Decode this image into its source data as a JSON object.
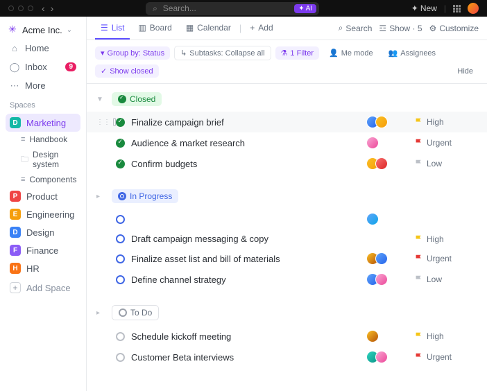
{
  "topbar": {
    "search_placeholder": "Search...",
    "ai_label": "AI",
    "new_label": "New"
  },
  "workspace": {
    "name": "Acme Inc."
  },
  "nav": {
    "home": "Home",
    "inbox": "Inbox",
    "inbox_badge": "9",
    "more": "More"
  },
  "section_spaces": "Spaces",
  "spaces": [
    {
      "letter": "D",
      "color": "#14b8a6",
      "label": "Marketing",
      "active": true
    },
    {
      "letter": "P",
      "color": "#ef4444",
      "label": "Product"
    },
    {
      "letter": "E",
      "color": "#f59e0b",
      "label": "Engineering"
    },
    {
      "letter": "D",
      "color": "#3b82f6",
      "label": "Design"
    },
    {
      "letter": "F",
      "color": "#8b5cf6",
      "label": "Finance"
    },
    {
      "letter": "H",
      "color": "#f97316",
      "label": "HR"
    }
  ],
  "marketing_subs": [
    {
      "icon": "≡",
      "label": "Handbook"
    },
    {
      "icon": "🗀",
      "label": "Design system"
    },
    {
      "icon": "≡",
      "label": "Components"
    }
  ],
  "add_space": "Add Space",
  "tabs": {
    "list": "List",
    "board": "Board",
    "calendar": "Calendar",
    "add": "Add"
  },
  "tabs_right": {
    "search": "Search",
    "show": "Show · 5",
    "customize": "Customize"
  },
  "filters": {
    "group": "Group by: Status",
    "subtasks": "Subtasks: Collapse all",
    "filter": "1 Filter",
    "me": "Me mode",
    "assignees": "Assignees",
    "closed": "Show closed",
    "hide": "Hide"
  },
  "groups": [
    {
      "status": "Closed",
      "pillClass": "closed",
      "dotClass": "closed-d",
      "ringClass": "ring-closed",
      "tasks": [
        {
          "name": "Finalize campaign brief",
          "avs": [
            "linear-gradient(135deg,#60a5fa,#2563eb)",
            "linear-gradient(135deg,#fbbf24,#f59e0b)"
          ],
          "prio": "High",
          "flag": "high",
          "hl": true
        },
        {
          "name": "Audience & market research",
          "avs": [
            "linear-gradient(135deg,#f9a8d4,#ec4899)"
          ],
          "prio": "Urgent",
          "flag": "urgent"
        },
        {
          "name": "Confirm budgets",
          "avs": [
            "linear-gradient(135deg,#fbbf24,#f59e0b)",
            "linear-gradient(135deg,#f87171,#dc2626)"
          ],
          "prio": "Low",
          "flag": "low"
        }
      ]
    },
    {
      "status": "In Progress",
      "pillClass": "progress",
      "dotClass": "prog-d",
      "ringClass": "ring-prog",
      "tasks": [
        {
          "name": "",
          "avs": [
            "linear-gradient(135deg,#60a5fa,#0ea5e9)"
          ],
          "prio": "",
          "flag": "",
          "blank": true
        },
        {
          "name": "Draft campaign messaging & copy",
          "avs": [],
          "prio": "High",
          "flag": "high"
        },
        {
          "name": "Finalize asset list and bill of materials",
          "avs": [
            "linear-gradient(135deg,#fbbf24,#b45309)",
            "linear-gradient(135deg,#60a5fa,#2563eb)"
          ],
          "prio": "Urgent",
          "flag": "urgent"
        },
        {
          "name": "Define channel strategy",
          "avs": [
            "linear-gradient(135deg,#60a5fa,#2563eb)",
            "linear-gradient(135deg,#f9a8d4,#ec4899)"
          ],
          "prio": "Low",
          "flag": "low"
        }
      ]
    },
    {
      "status": "To Do",
      "pillClass": "todo",
      "dotClass": "todo-d",
      "ringClass": "ring-todo",
      "tasks": [
        {
          "name": "Schedule kickoff meeting",
          "avs": [
            "linear-gradient(135deg,#fbbf24,#b45309)"
          ],
          "prio": "High",
          "flag": "high"
        },
        {
          "name": "Customer Beta interviews",
          "avs": [
            "linear-gradient(135deg,#2dd4bf,#0d9488)",
            "linear-gradient(135deg,#f9a8d4,#ec4899)"
          ],
          "prio": "Urgent",
          "flag": "urgent"
        }
      ]
    }
  ]
}
